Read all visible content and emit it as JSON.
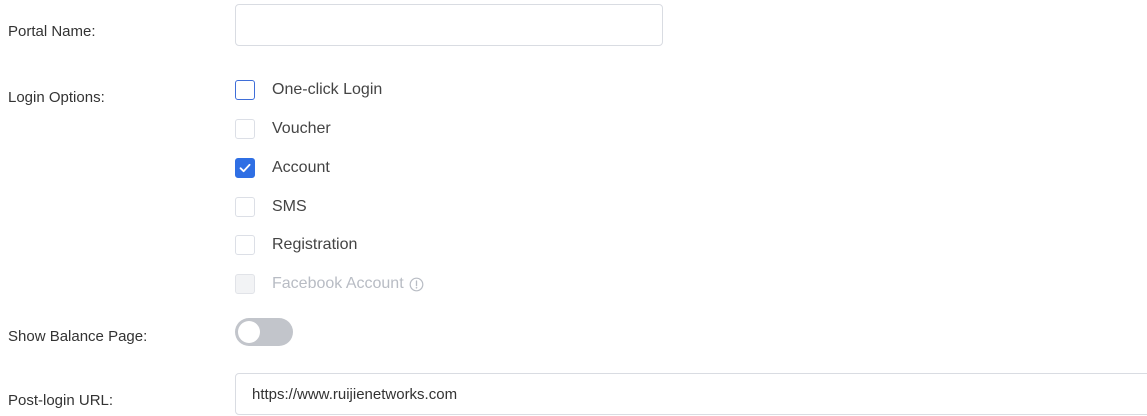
{
  "form": {
    "portal_name": {
      "label": "Portal Name:",
      "value": "",
      "placeholder": ""
    },
    "login_options": {
      "label": "Login Options:",
      "options": [
        {
          "label": "One-click Login",
          "checked": false,
          "disabled": false,
          "focused": true
        },
        {
          "label": "Voucher",
          "checked": false,
          "disabled": false,
          "focused": false
        },
        {
          "label": "Account",
          "checked": true,
          "disabled": false,
          "focused": false
        },
        {
          "label": "SMS",
          "checked": false,
          "disabled": false,
          "focused": false
        },
        {
          "label": "Registration",
          "checked": false,
          "disabled": false,
          "focused": false
        },
        {
          "label": "Facebook Account",
          "checked": false,
          "disabled": true,
          "focused": false,
          "icon": "info-icon"
        }
      ]
    },
    "show_balance_page": {
      "label": "Show Balance Page:",
      "enabled": false
    },
    "post_login_url": {
      "label": "Post-login URL:",
      "value": "https://www.ruijienetworks.com"
    }
  },
  "colors": {
    "accent": "#2f6fe4",
    "toggle_off": "#c2c5cb",
    "border": "#d9dce2",
    "disabled_text": "#b8bcc4"
  }
}
